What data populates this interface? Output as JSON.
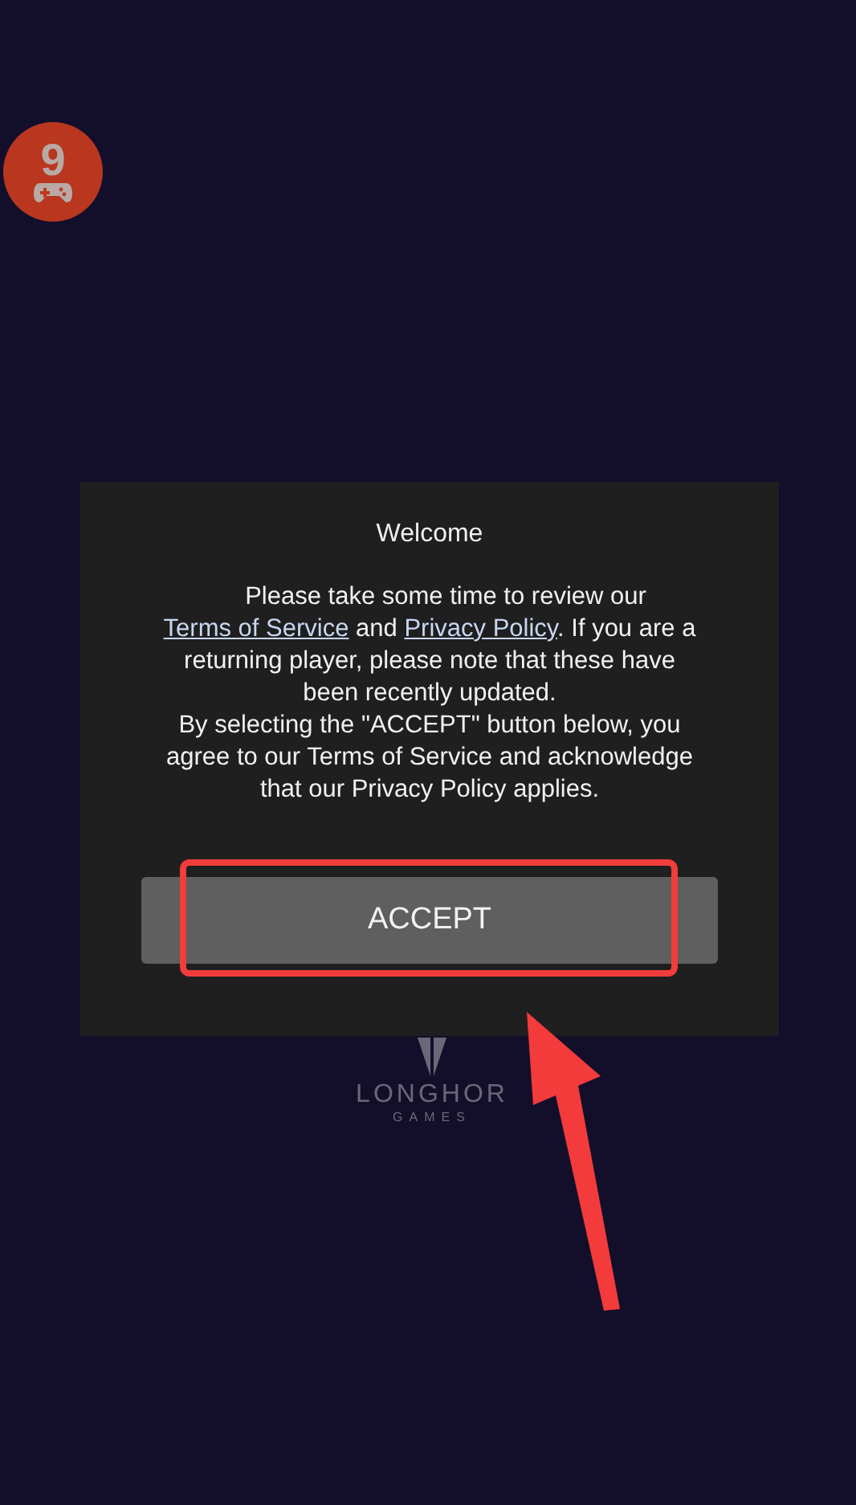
{
  "badge": {
    "label": "9"
  },
  "dialog": {
    "title": "Welcome",
    "message": [
      {
        "kind": "text",
        "text": "Please take some time to review our "
      },
      {
        "kind": "link",
        "text": "Terms of Service"
      },
      {
        "kind": "text",
        "text": " and "
      },
      {
        "kind": "link",
        "text": "Privacy Policy"
      },
      {
        "kind": "text",
        "text": ". If you are a returning player, please note that these have been recently updated."
      }
    ],
    "notice": "By selecting the \"ACCEPT\" button below, you agree to our Terms of Service and acknowledge that our Privacy Policy applies.",
    "button": "ACCEPT"
  },
  "logo": {
    "name": "LONGHOR",
    "subtitle": "GAMES"
  }
}
